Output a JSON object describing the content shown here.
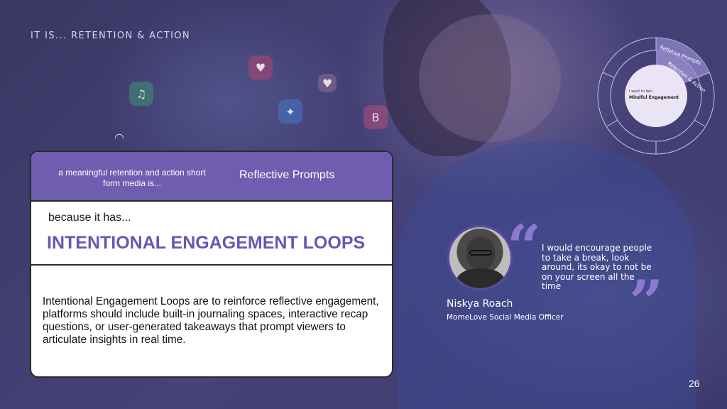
{
  "section_title": "IT IS... RETENTION & ACTION",
  "card": {
    "intro": "a meaningful retention and action short form media is...",
    "prompt_label": "Reflective Prompts",
    "because": "because it has...",
    "headline": "INTENTIONAL ENGAGEMENT LOOPS",
    "body": "Intentional Engagement Loops are to reinforce reflective engagement, platforms should include built-in journaling spaces, interactive recap questions, or user-generated takeaways that prompt viewers to articulate insights in real time."
  },
  "diagram": {
    "outer_label": "Refletive Prompts",
    "inner_label": "Retention & Action",
    "center_small": "I want to feel",
    "center_bold": "Mindful Engagement"
  },
  "quote": {
    "text": "I would encourage people to take a break, look around, its okay to not be on your screen all the time",
    "name": "Niskya Roach",
    "role": "MomeLove Social Media Officer"
  },
  "page_number": "26",
  "colors": {
    "accent": "#6f5db0",
    "headline": "#6b55b3",
    "quote_mark": "#8c7ad0"
  }
}
